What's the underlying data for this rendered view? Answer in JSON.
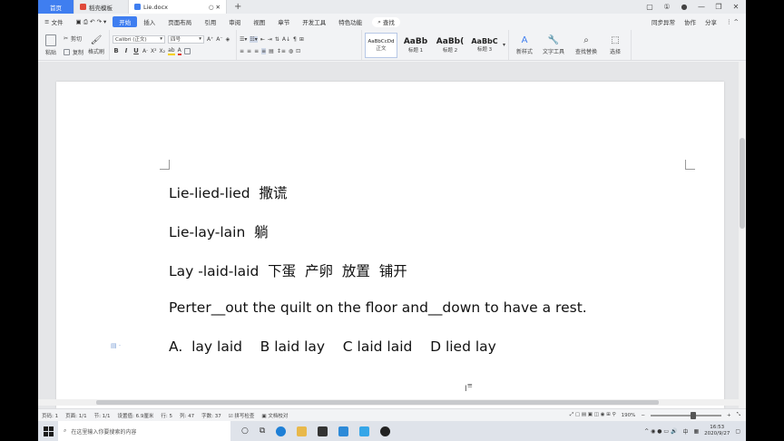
{
  "tabs": {
    "home": "首页",
    "template": "稻壳模板",
    "document": "Lie.docx",
    "new_tab": "+"
  },
  "menu": {
    "items": [
      "文件",
      "开始",
      "插入",
      "页面布局",
      "引用",
      "审阅",
      "视图",
      "章节",
      "开发工具",
      "特色功能"
    ],
    "active": "开始",
    "search": "查找",
    "right": [
      "同步异常",
      "协作",
      "分享"
    ]
  },
  "ribbon": {
    "paste": "粘贴",
    "cut": "剪切",
    "copy": "复制",
    "format_painter": "格式刷",
    "font_name": "Calibri (正文)",
    "font_size": "四号",
    "styles": [
      {
        "sample": "AaBbCcDd",
        "label": "正文"
      },
      {
        "sample": "AaBb",
        "label": "标题 1"
      },
      {
        "sample": "AaBb(",
        "label": "标题 2"
      },
      {
        "sample": "AaBbC",
        "label": "标题 3"
      }
    ],
    "new_style": "新样式",
    "text_tools": "文字工具",
    "find_replace": "查找替换",
    "select": "选择"
  },
  "document": {
    "lines": [
      "Lie-lied-lied  撒谎",
      "Lie-lay-lain  躺",
      "Lay -laid-laid  下蛋  产卵  放置  铺开",
      "Perter__out the quilt on the floor and__down to have a rest.",
      "A.  lay laid    B laid lay    C laid laid    D lied lay"
    ]
  },
  "status": {
    "page_no": "页码: 1",
    "pages": "页面: 1/1",
    "section": "节: 1/1",
    "setting": "设置值: 6.9厘米",
    "row": "行: 5",
    "col": "列: 47",
    "words": "字数: 37",
    "spellcheck": "拼写检查",
    "proofread": "文档校对",
    "zoom": "190%"
  },
  "taskbar": {
    "search_placeholder": "在这里输入你要搜索的内容",
    "ime": "中",
    "time": "16:53",
    "date": "2020/9/27"
  }
}
